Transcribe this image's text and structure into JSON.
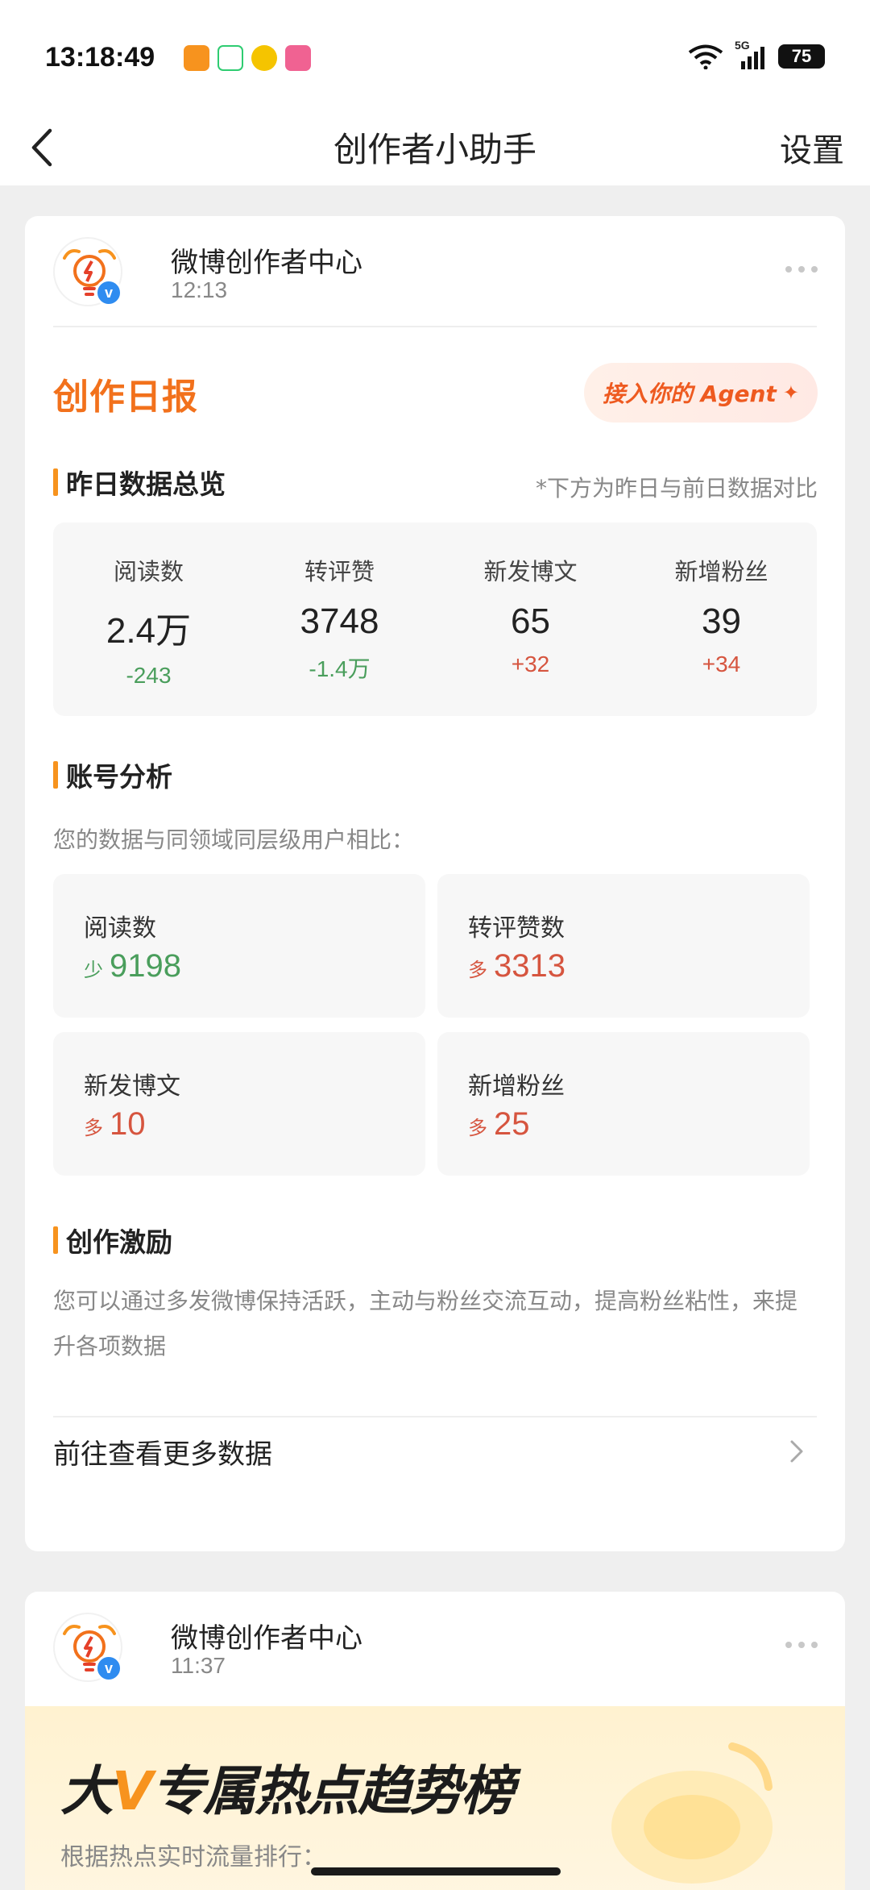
{
  "status_bar": {
    "time": "13:18:49",
    "network": "5G",
    "battery": "75"
  },
  "nav": {
    "title": "创作者小助手",
    "settings": "设置"
  },
  "card1": {
    "sender_name": "微博创作者中心",
    "time": "12:13",
    "report_title": "创作日报",
    "agent_button": "接入你的 Agent",
    "overview": {
      "title": "昨日数据总览",
      "note": "*下方为昨日与前日数据对比",
      "stats": [
        {
          "label": "阅读数",
          "value": "2.4万",
          "delta": "-243",
          "trend": "down"
        },
        {
          "label": "转评赞",
          "value": "3748",
          "delta": "-1.4万",
          "trend": "down"
        },
        {
          "label": "新发博文",
          "value": "65",
          "delta": "+32",
          "trend": "up"
        },
        {
          "label": "新增粉丝",
          "value": "39",
          "delta": "+34",
          "trend": "up"
        }
      ]
    },
    "analysis": {
      "title": "账号分析",
      "description": "您的数据与同领域同层级用户相比：",
      "tiles": [
        {
          "label": "阅读数",
          "prefix": "少",
          "value": "9198",
          "trend": "down"
        },
        {
          "label": "转评赞数",
          "prefix": "多",
          "value": "3313",
          "trend": "up"
        },
        {
          "label": "新发博文",
          "prefix": "多",
          "value": "10",
          "trend": "up"
        },
        {
          "label": "新增粉丝",
          "prefix": "多",
          "value": "25",
          "trend": "up"
        }
      ]
    },
    "incentive": {
      "title": "创作激励",
      "text": "您可以通过多发微博保持活跃，主动与粉丝交流互动，提高粉丝粘性，来提升各项数据"
    },
    "more_link": "前往查看更多数据"
  },
  "card2": {
    "sender_name": "微博创作者中心",
    "time": "11:37",
    "banner_title_a": "大",
    "banner_title_v": "V",
    "banner_title_b": "专属热点趋势榜",
    "banner_sub": "根据热点实时流量排行："
  },
  "colors": {
    "accent_orange": "#f2711c",
    "section_bar": "#f7931e",
    "negative": "#4a9e5c",
    "positive": "#d6553f",
    "verified": "#2f8cf0"
  }
}
